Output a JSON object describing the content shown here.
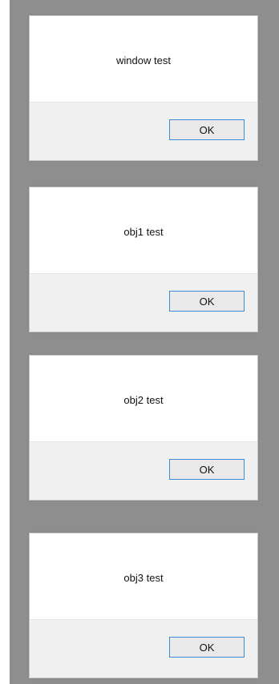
{
  "dialogs": [
    {
      "message": "window test",
      "button_label": "OK"
    },
    {
      "message": "obj1 test",
      "button_label": "OK"
    },
    {
      "message": "obj2 test",
      "button_label": "OK"
    },
    {
      "message": "obj3 test",
      "button_label": "OK"
    }
  ],
  "colors": {
    "backdrop": "#8e8e8e",
    "dialog_body": "#ffffff",
    "button_bar": "#f0f0f0",
    "button_border": "#3c8fd6"
  }
}
